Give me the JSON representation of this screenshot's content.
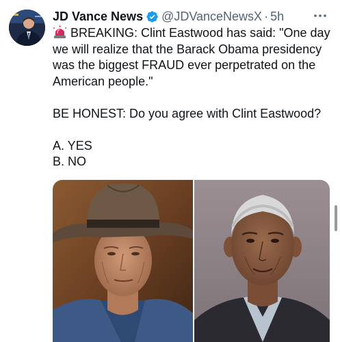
{
  "tweet": {
    "author": {
      "display_name": "JD Vance News",
      "verified": true,
      "handle": "@JDVanceNewsX",
      "separator": "·",
      "time": "5h"
    },
    "body": {
      "siren_icon": "police-light-emoji",
      "lines": [
        "BREAKING: Clint Eastwood has said: \"One day we will realize that the Barack Obama presidency was the biggest FRAUD ever perpetrated on the American people.\"",
        "BE HONEST: Do you agree with Clint Eastwood?",
        "A. YES",
        "B. NO"
      ]
    },
    "media": {
      "left_photo": "man-in-cowboy-hat-photo",
      "right_photo": "man-in-suit-photo"
    }
  },
  "colors": {
    "text": "#0f1419",
    "secondary": "#536471",
    "verified_blue": "#1d9bf0"
  }
}
